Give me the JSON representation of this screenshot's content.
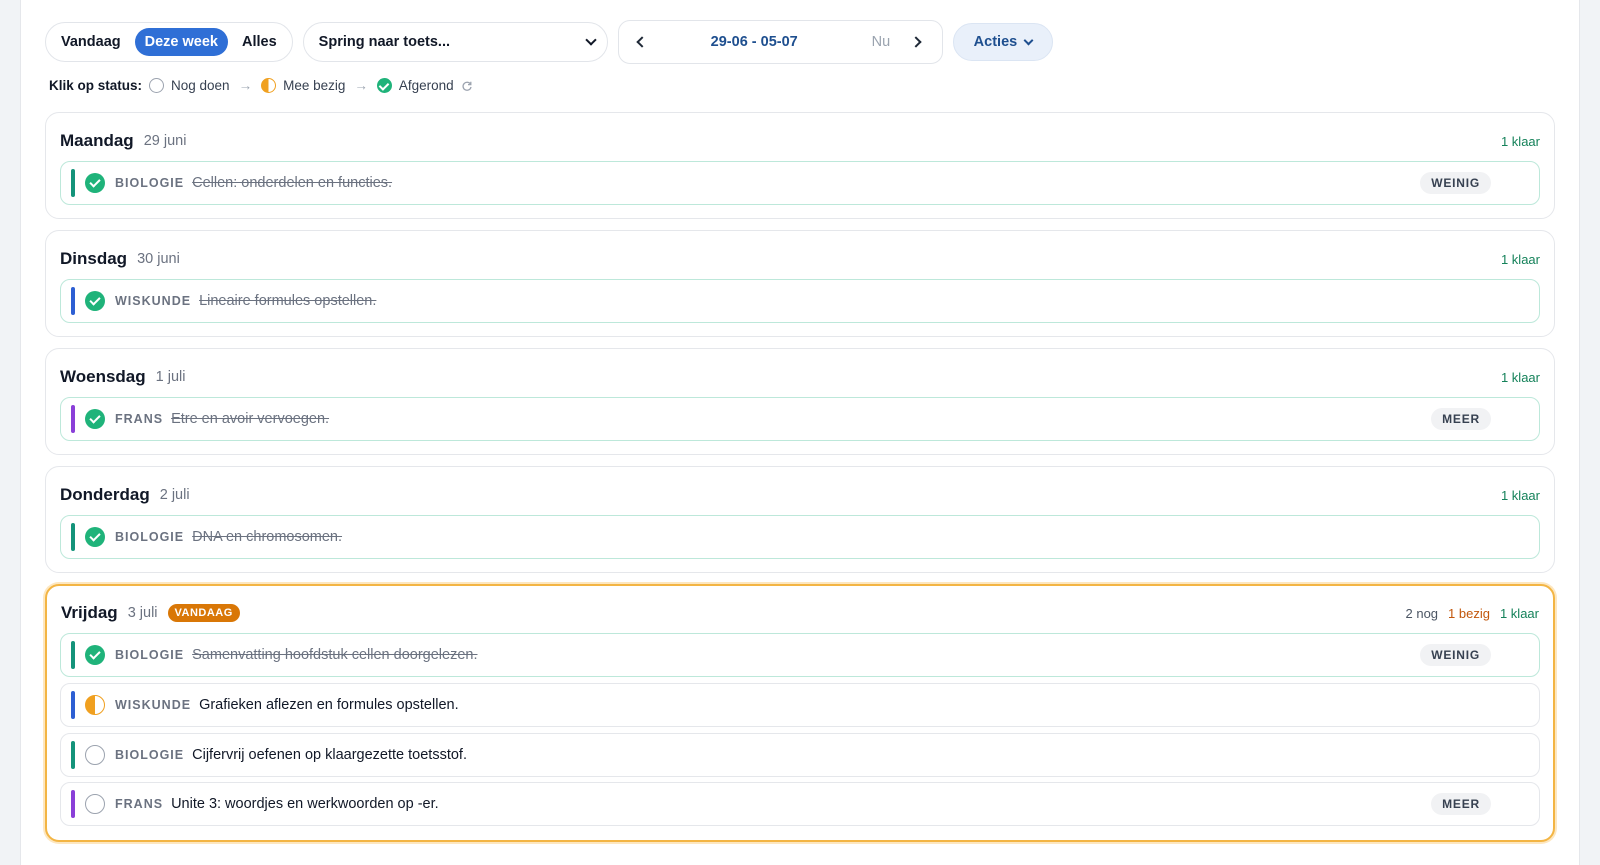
{
  "filters": {
    "tabs": [
      {
        "label": "Vandaag",
        "active": false
      },
      {
        "label": "Deze week",
        "active": true
      },
      {
        "label": "Alles",
        "active": false
      }
    ]
  },
  "jump": {
    "label": "Spring naar toets..."
  },
  "datenav": {
    "range": "29-06 - 05-07",
    "now_label": "Nu"
  },
  "actions": {
    "label": "Acties"
  },
  "legend": {
    "prefix": "Klik op status:",
    "todo": "Nog doen",
    "busy": "Mee bezig",
    "done": "Afgerond"
  },
  "colors": {
    "accent": "#2f6fd6",
    "done": "#1fb37a",
    "busy": "#f0a020",
    "biologie": "#14937a",
    "wiskunde": "#2d5fd3",
    "frans": "#8a3fd8",
    "today_border": "#f3b544"
  },
  "days": [
    {
      "name": "Maandag",
      "date": "29 juni",
      "today": false,
      "counts": {
        "todo": "",
        "busy": "",
        "done": "1 klaar"
      },
      "tasks": [
        {
          "subject": "BIOLOGIE",
          "title": "Cellen: onderdelen en functies.",
          "status": "done",
          "tag": "WEINIG"
        }
      ]
    },
    {
      "name": "Dinsdag",
      "date": "30 juni",
      "today": false,
      "counts": {
        "todo": "",
        "busy": "",
        "done": "1 klaar"
      },
      "tasks": [
        {
          "subject": "WISKUNDE",
          "title": "Lineaire formules opstellen.",
          "status": "done",
          "tag": ""
        }
      ]
    },
    {
      "name": "Woensdag",
      "date": "1 juli",
      "today": false,
      "counts": {
        "todo": "",
        "busy": "",
        "done": "1 klaar"
      },
      "tasks": [
        {
          "subject": "FRANS",
          "title": "Etre en avoir vervoegen.",
          "status": "done",
          "tag": "MEER"
        }
      ]
    },
    {
      "name": "Donderdag",
      "date": "2 juli",
      "today": false,
      "counts": {
        "todo": "",
        "busy": "",
        "done": "1 klaar"
      },
      "tasks": [
        {
          "subject": "BIOLOGIE",
          "title": "DNA en chromosomen.",
          "status": "done",
          "tag": ""
        }
      ]
    },
    {
      "name": "Vrijdag",
      "date": "3 juli",
      "today": true,
      "today_label": "VANDAAG",
      "counts": {
        "todo": "2 nog",
        "busy": "1 bezig",
        "done": "1 klaar"
      },
      "tasks": [
        {
          "subject": "BIOLOGIE",
          "title": "Samenvatting hoofdstuk cellen doorgelezen.",
          "status": "done",
          "tag": "WEINIG"
        },
        {
          "subject": "WISKUNDE",
          "title": "Grafieken aflezen en formules opstellen.",
          "status": "busy",
          "tag": ""
        },
        {
          "subject": "BIOLOGIE",
          "title": "Cijfervrij oefenen op klaargezette toetsstof.",
          "status": "todo",
          "tag": ""
        },
        {
          "subject": "FRANS",
          "title": "Unite 3: woordjes en werkwoorden op -er.",
          "status": "todo",
          "tag": "MEER"
        }
      ]
    }
  ]
}
